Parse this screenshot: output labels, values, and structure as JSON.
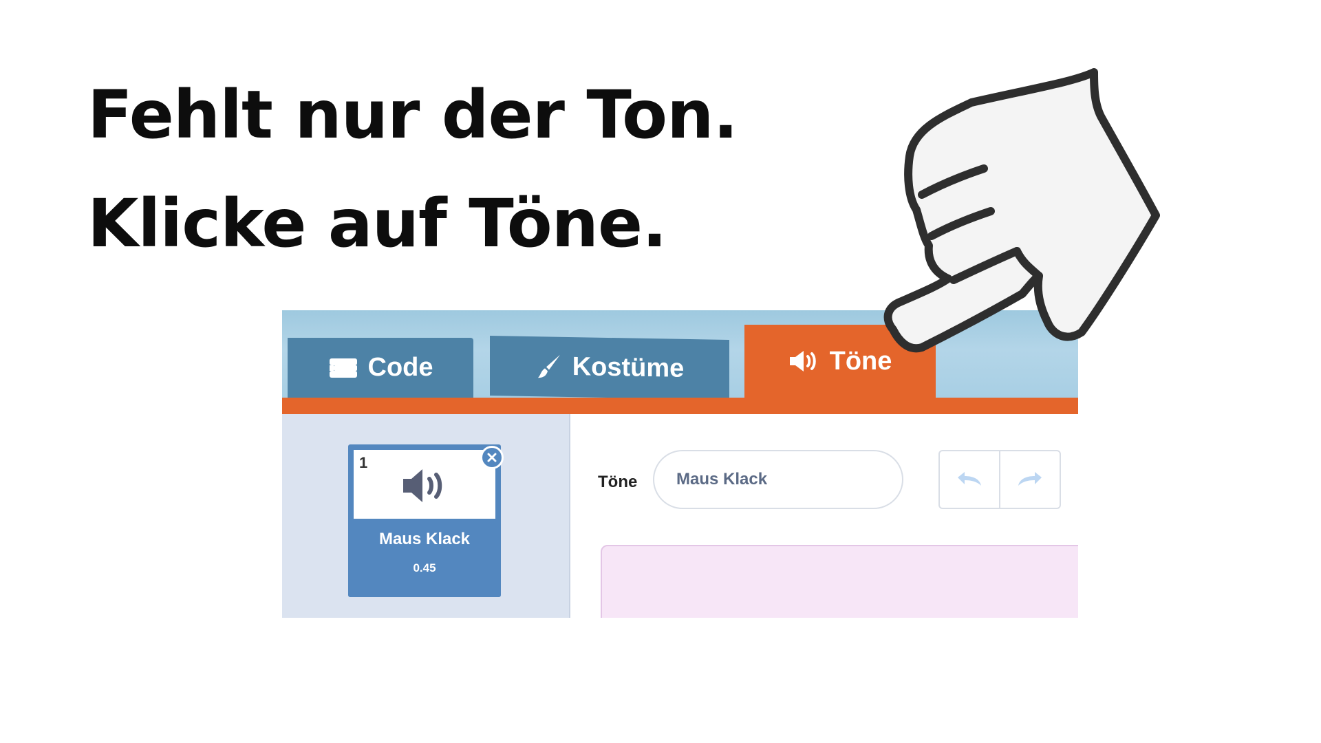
{
  "instruction": {
    "line1": "Fehlt nur der Ton.",
    "line2": "Klicke auf Töne."
  },
  "tabs": [
    {
      "label": "Code",
      "icon": "code-blocks-icon",
      "active": false
    },
    {
      "label": "Kostüme",
      "icon": "paintbrush-icon",
      "active": false
    },
    {
      "label": "Töne",
      "icon": "speaker-icon",
      "active": true
    }
  ],
  "sound_list": {
    "items": [
      {
        "index": "1",
        "name": "Maus Klack",
        "duration": "0.45",
        "icon": "speaker-icon"
      }
    ]
  },
  "sound_editor": {
    "field_label": "Töne",
    "name_value": "Maus Klack",
    "undo_icon": "undo-icon",
    "redo_icon": "redo-icon"
  },
  "colors": {
    "accent_orange": "#e4652b",
    "tab_blue": "#4d82a6",
    "tile_blue": "#5387bf",
    "sidebar_bg": "#dbe3f0",
    "waveform_bg": "#f7e6f7"
  }
}
